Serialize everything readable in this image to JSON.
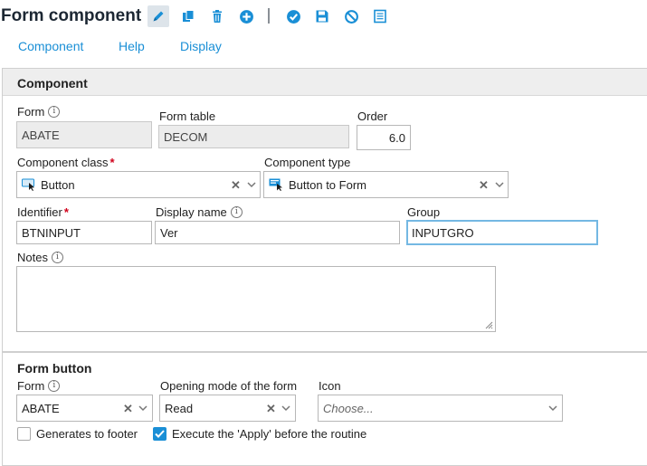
{
  "header": {
    "title": "Form component",
    "toolbar": [
      "edit-icon",
      "copy-icon",
      "delete-icon",
      "add-icon",
      "confirm-icon",
      "save-icon",
      "cancel-icon",
      "list-icon"
    ]
  },
  "menu": {
    "items": [
      "Component",
      "Help",
      "Display"
    ]
  },
  "component": {
    "section_title": "Component",
    "form": {
      "label": "Form",
      "value": "ABATE"
    },
    "form_table": {
      "label": "Form table",
      "value": "DECOM"
    },
    "order": {
      "label": "Order",
      "value": "6.0"
    },
    "component_class": {
      "label": "Component class",
      "value": "Button"
    },
    "component_type": {
      "label": "Component type",
      "value": "Button to Form"
    },
    "identifier": {
      "label": "Identifier",
      "value": "BTNINPUT"
    },
    "display_name": {
      "label": "Display name",
      "value": "Ver"
    },
    "group": {
      "label": "Group",
      "value": "INPUTGRO"
    },
    "notes": {
      "label": "Notes",
      "value": ""
    }
  },
  "form_button": {
    "section_title": "Form button",
    "form": {
      "label": "Form",
      "value": "ABATE"
    },
    "opening_mode": {
      "label": "Opening mode of the form",
      "value": "Read"
    },
    "icon": {
      "label": "Icon",
      "placeholder": "Choose..."
    },
    "generates_footer": {
      "label": "Generates to footer",
      "checked": false
    },
    "execute_apply": {
      "label": "Execute the 'Apply' before the routine",
      "checked": true
    }
  },
  "colors": {
    "accent": "#1a8fd6",
    "required": "#d0021b",
    "focus": "#74b8e3"
  }
}
